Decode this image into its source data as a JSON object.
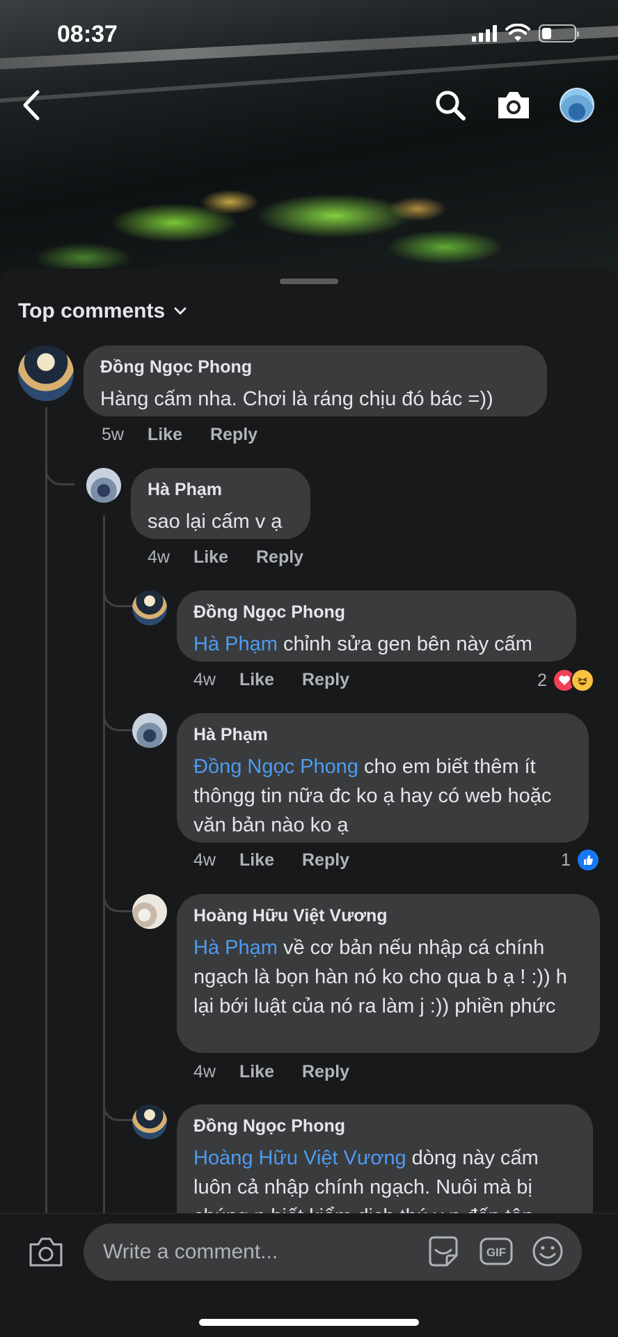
{
  "status": {
    "time": "08:37"
  },
  "sheet": {
    "sort_label": "Top comments"
  },
  "comments": [
    {
      "author": "Đồng Ngọc Phong",
      "text": "Hàng cấm nha. Chơi là ráng chịu đó bác =))",
      "time": "5w",
      "like": "Like",
      "reply": "Reply"
    },
    {
      "author": "Hà Phạm",
      "text": "sao lại cấm v ạ",
      "time": "4w",
      "like": "Like",
      "reply": "Reply"
    },
    {
      "author": "Đồng Ngọc Phong",
      "mention": "Hà Phạm",
      "text": " chỉnh sửa gen bên này cấm",
      "time": "4w",
      "like": "Like",
      "reply": "Reply",
      "reaction_count": "2"
    },
    {
      "author": "Hà Phạm",
      "mention": "Đồng Ngọc Phong",
      "text": " cho em biết thêm ít thôngg tin  nữa đc ko ạ hay  có web hoặc văn bản nào ko ạ",
      "time": "4w",
      "like": "Like",
      "reply": "Reply",
      "reaction_count": "1"
    },
    {
      "author": "Hoàng Hữu Việt Vương",
      "mention": "Hà Phạm",
      "text": " về cơ bản nếu nhập cá chính ngạch là bọn hàn nó ko cho qua b ạ ! :)) h lại bới luật của nó ra làm j :)) phiền phức",
      "time": "4w",
      "like": "Like",
      "reply": "Reply"
    },
    {
      "author": "Đồng Ngọc Phong",
      "mention": "Hoàng Hữu Việt Vương",
      "text": " dòng này cấm luôn cả nhập chính ngạch. Nuôi mà bị chúng n biết kiểm dịch thú y n đến tận"
    }
  ],
  "composer": {
    "placeholder": "Write a comment..."
  },
  "icons": {
    "back": "chevron-left-icon",
    "search": "search-icon",
    "camera": "camera-icon",
    "sticker": "sticker-icon",
    "gif": "gif-icon",
    "emoji": "emoji-icon",
    "reaction_love": "love-reaction-icon",
    "reaction_haha": "haha-reaction-icon",
    "reaction_like": "like-reaction-icon"
  },
  "colors": {
    "background": "#18191a",
    "bubble": "#3a3b3c",
    "mention": "#4e9bf3",
    "secondary_text": "#b0b3b8"
  }
}
